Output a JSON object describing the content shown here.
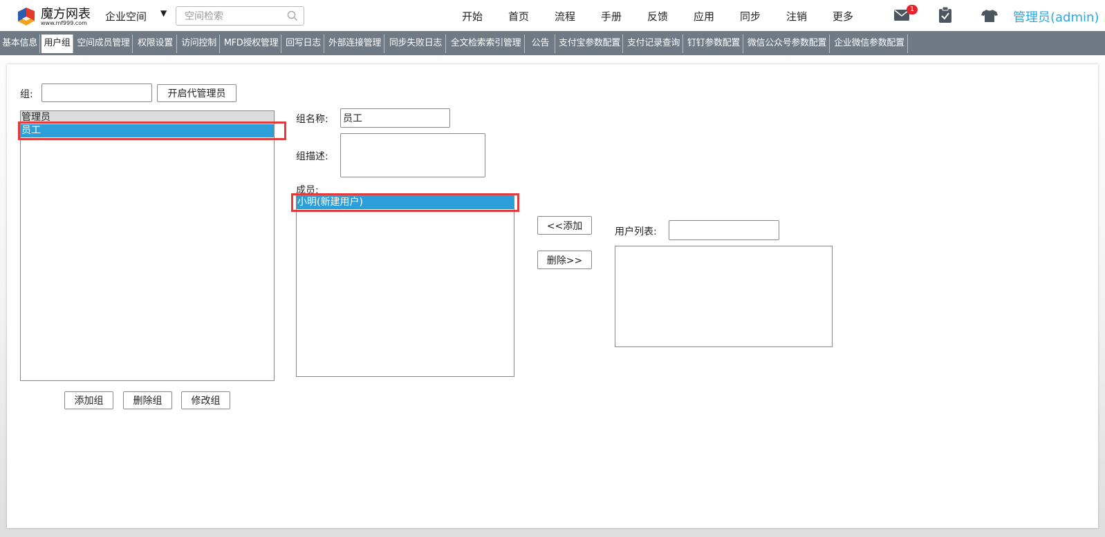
{
  "header": {
    "logo_name": "魔方网表",
    "logo_url": "www.mf999.com",
    "space_label": "企业空间",
    "search_placeholder": "空间检索",
    "nav": [
      "开始",
      "首页",
      "流程",
      "手册",
      "反馈",
      "应用",
      "同步",
      "注销",
      "更多"
    ],
    "mail_badge": "1",
    "admin_label": "管理员(admin)",
    "icons": [
      "search-icon",
      "mail-icon",
      "clipboard-icon",
      "shirt-icon",
      "chevron-down-icon"
    ]
  },
  "tabs": [
    "基本信息",
    "用户组",
    "空间成员管理",
    "权限设置",
    "访问控制",
    "MFD授权管理",
    "回写日志",
    "外部连接管理",
    "同步失败日志",
    "全文检索索引管理",
    "公告",
    "支付宝参数配置",
    "支付记录查询",
    "钉钉参数配置",
    "微信公众号参数配置",
    "企业微信参数配置"
  ],
  "active_tab": "用户组",
  "group_panel": {
    "group_label": "组:",
    "group_value": "",
    "enable_sub_admin_button": "开启代管理员",
    "groups": [
      "管理员",
      "员工"
    ],
    "selected_group": "员工",
    "add_group_button": "添加组",
    "delete_group_button": "删除组",
    "modify_group_button": "修改组"
  },
  "group_detail": {
    "name_label": "组名称:",
    "name_value": "员工",
    "desc_label": "组描述:",
    "desc_value": "",
    "members_label": "成员:",
    "members": [
      "小明(新建用户)"
    ],
    "selected_member": "小明(新建用户)"
  },
  "member_actions": {
    "add_button": "<<添加",
    "remove_button": "删除>>"
  },
  "user_list": {
    "label": "用户列表:",
    "filter_value": "",
    "users": []
  },
  "colors": {
    "accent": "#29a8e0",
    "selection": "#2c9fd8",
    "highlight_border": "#e23b3b",
    "tabbar": "#6f7a84",
    "badge": "#e5212d"
  }
}
